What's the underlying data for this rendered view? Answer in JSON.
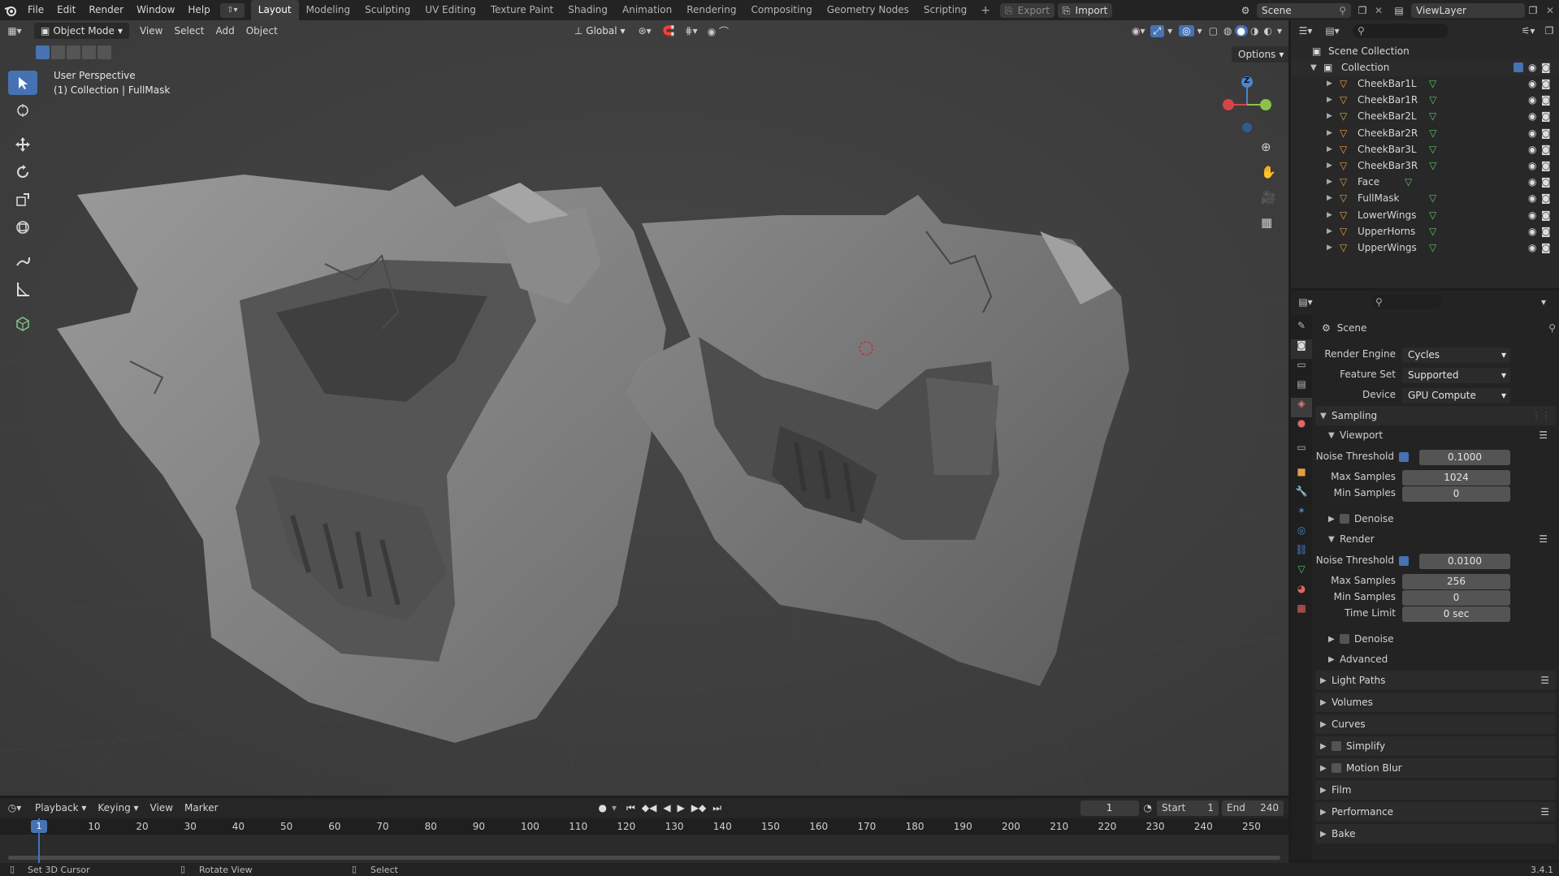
{
  "app_menu": [
    "File",
    "Edit",
    "Render",
    "Window",
    "Help"
  ],
  "workspaces": [
    "Layout",
    "Modeling",
    "Sculpting",
    "UV Editing",
    "Texture Paint",
    "Shading",
    "Animation",
    "Rendering",
    "Compositing",
    "Geometry Nodes",
    "Scripting"
  ],
  "active_workspace": "Layout",
  "topbar": {
    "export_label": "Export",
    "import_label": "Import",
    "scene_name": "Scene",
    "view_layer": "ViewLayer"
  },
  "viewport": {
    "mode": "Object Mode",
    "menus": [
      "View",
      "Select",
      "Add",
      "Object"
    ],
    "orientation": "Global",
    "options_label": "Options",
    "overlay_title": "User Perspective",
    "overlay_subtitle": "(1) Collection | FullMask",
    "gizmo_z": "Z"
  },
  "outliner": {
    "root": "Scene Collection",
    "collection": "Collection",
    "objects": [
      "CheekBar1L",
      "CheekBar1R",
      "CheekBar2L",
      "CheekBar2R",
      "CheekBar3L",
      "CheekBar3R",
      "Face",
      "FullMask",
      "LowerWings",
      "UpperHorns",
      "UpperWings"
    ]
  },
  "properties": {
    "context": "Scene",
    "render_engine_label": "Render Engine",
    "render_engine": "Cycles",
    "feature_set_label": "Feature Set",
    "feature_set": "Supported",
    "device_label": "Device",
    "device": "GPU Compute",
    "sampling": "Sampling",
    "viewport_label": "Viewport",
    "render_label": "Render",
    "noise_threshold_label": "Noise Threshold",
    "max_samples_label": "Max Samples",
    "min_samples_label": "Min Samples",
    "time_limit_label": "Time Limit",
    "denoise_label": "Denoise",
    "advanced_label": "Advanced",
    "viewport_noise": "0.1000",
    "viewport_max": "1024",
    "viewport_min": "0",
    "render_noise": "0.0100",
    "render_max": "256",
    "render_min": "0",
    "render_time": "0 sec",
    "sections": [
      "Light Paths",
      "Volumes",
      "Curves",
      "Simplify",
      "Motion Blur",
      "Film",
      "Performance",
      "Bake"
    ]
  },
  "timeline": {
    "menus": [
      "Playback",
      "Keying",
      "View",
      "Marker"
    ],
    "current_frame": "1",
    "start_label": "Start",
    "start": "1",
    "end_label": "End",
    "end": "240",
    "ticks": [
      "1",
      "10",
      "20",
      "30",
      "40",
      "50",
      "60",
      "70",
      "80",
      "90",
      "100",
      "110",
      "120",
      "130",
      "140",
      "150",
      "160",
      "170",
      "180",
      "190",
      "200",
      "210",
      "220",
      "230",
      "240",
      "250"
    ]
  },
  "statusbar": {
    "left": "Set 3D Cursor",
    "mid": "Rotate View",
    "right": "Select",
    "version": "3.4.1"
  },
  "colors": {
    "accent": "#4772b3",
    "viewport_bg": "#3b3b3b",
    "panel_bg": "#232323",
    "mesh_icon": "#e0a044",
    "vertex_green": "#59c46b"
  }
}
